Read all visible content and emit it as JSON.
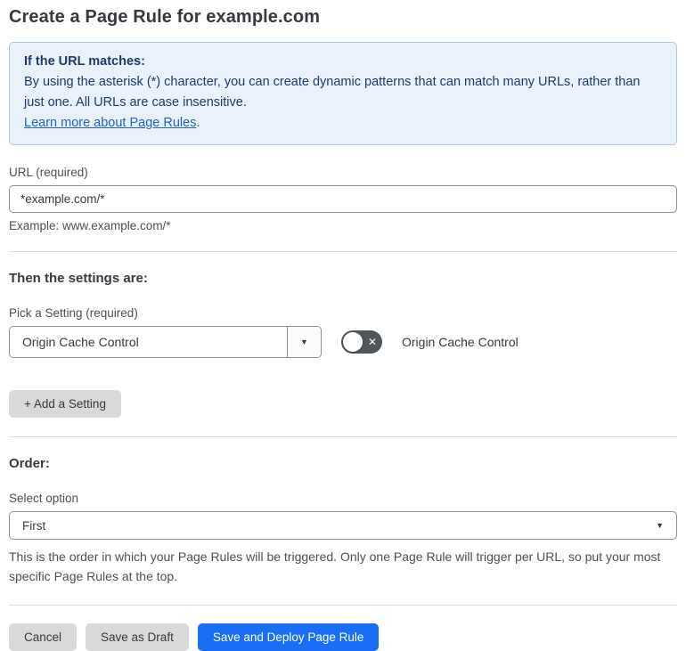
{
  "page": {
    "title": "Create a Page Rule for example.com"
  },
  "info_box": {
    "heading": "If the URL matches:",
    "body": "By using the asterisk (*) character, you can create dynamic patterns that can match many URLs, rather than just one. All URLs are case insensitive.",
    "link_label": "Learn more about Page Rules",
    "link_suffix": "."
  },
  "url_field": {
    "label": "URL (required)",
    "value": "*example.com/*",
    "helper": "Example: www.example.com/*"
  },
  "settings_section": {
    "heading": "Then the settings are:",
    "picker_label": "Pick a Setting (required)",
    "picker_value": "Origin Cache Control",
    "toggle_label": "Origin Cache Control",
    "toggle_state": "off",
    "add_setting_label": "+ Add a Setting"
  },
  "order_section": {
    "heading": "Order:",
    "select_label": "Select option",
    "select_value": "First",
    "helper": "This is the order in which your Page Rules will be triggered. Only one Page Rule will trigger per URL, so put your most specific Page Rules at the top."
  },
  "actions": {
    "cancel": "Cancel",
    "save_draft": "Save as Draft",
    "save_deploy": "Save and Deploy Page Rule"
  },
  "icons": {
    "caret_down": "▼",
    "x_mark": "✕"
  },
  "colors": {
    "accent_blue": "#1a6ef5",
    "info_bg": "#e9f2fb",
    "info_border": "#a7c7e8",
    "info_text": "#1e3a66",
    "link_blue": "#2160c4",
    "toggle_off_bg": "#50565c",
    "gray_button_bg": "#d9d9d9"
  }
}
